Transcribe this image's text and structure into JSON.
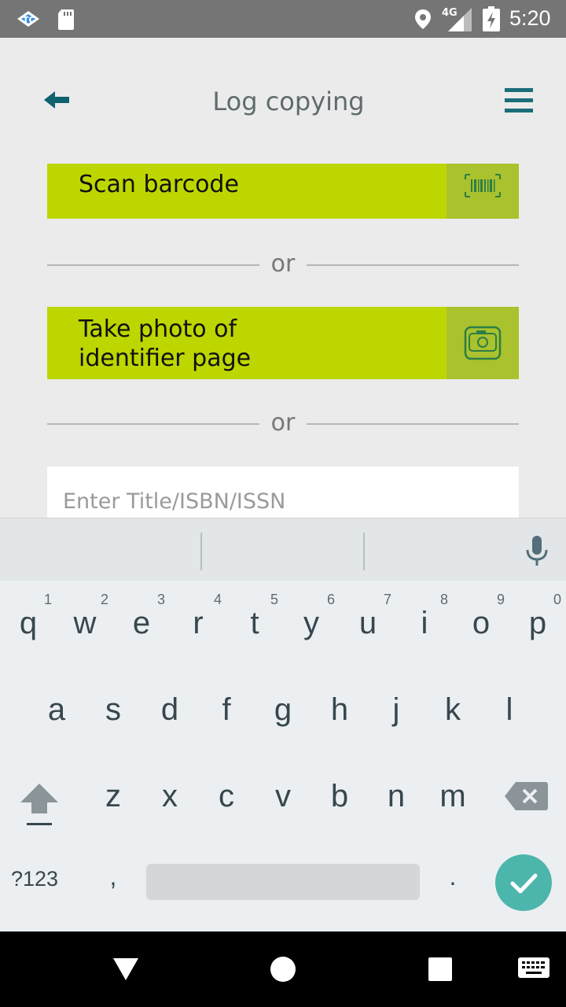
{
  "status_bar": {
    "network": "4G",
    "time": "5:20"
  },
  "header": {
    "title": "Log copying"
  },
  "scan_button": {
    "label": "Scan barcode"
  },
  "photo_button": {
    "label_line1": "Take photo of",
    "label_line2": "identifier page"
  },
  "divider_text": "or",
  "search": {
    "placeholder": "Enter Title/ISBN/ISSN",
    "value": ""
  },
  "keyboard": {
    "row1": [
      {
        "key": "q",
        "hint": "1"
      },
      {
        "key": "w",
        "hint": "2"
      },
      {
        "key": "e",
        "hint": "3"
      },
      {
        "key": "r",
        "hint": "4"
      },
      {
        "key": "t",
        "hint": "5"
      },
      {
        "key": "y",
        "hint": "6"
      },
      {
        "key": "u",
        "hint": "7"
      },
      {
        "key": "i",
        "hint": "8"
      },
      {
        "key": "o",
        "hint": "9"
      },
      {
        "key": "p",
        "hint": "0"
      }
    ],
    "row2": [
      "a",
      "s",
      "d",
      "f",
      "g",
      "h",
      "j",
      "k",
      "l"
    ],
    "row3": [
      "z",
      "x",
      "c",
      "v",
      "b",
      "n",
      "m"
    ],
    "symbols_label": "?123",
    "comma": ",",
    "period": "."
  },
  "colors": {
    "accent": "#bdd600",
    "accent_dark": "#a9c22d",
    "header_icon": "#1b6d7a",
    "keyboard_enter": "#4db6ac"
  },
  "icons": [
    "back-arrow-icon",
    "menu-icon",
    "barcode-icon",
    "camera-icon",
    "mic-icon",
    "shift-icon",
    "backspace-icon",
    "check-icon"
  ]
}
